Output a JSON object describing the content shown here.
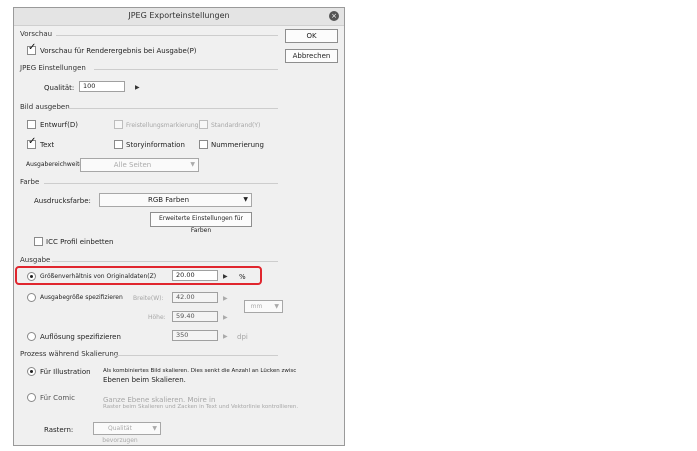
{
  "dialog": {
    "title": "JPEG Exporteinstellungen",
    "close": "×",
    "ok_label": "OK",
    "cancel_label": "Abbrechen"
  },
  "preview": {
    "section": "Vorschau",
    "checkbox_label": "Vorschau für Renderergebnis bei Ausgabe(P)",
    "checked": true
  },
  "jpeg": {
    "section": "JPEG Einstellungen",
    "quality_label": "Qualität:",
    "quality_value": "100"
  },
  "output_image": {
    "section": "Bild ausgeben",
    "draft": "Entwurf(D)",
    "border_mark": "Freistellungsmarkierung",
    "default_border": "Standardrand(Y)",
    "text": "Text",
    "text_checked": true,
    "story_info": "Storyinformation",
    "numbering": "Nummerierung",
    "range_label": "Ausgabereichweite:",
    "range_value": "Alle Seiten"
  },
  "color": {
    "section": "Farbe",
    "output_color_label": "Ausdrucksfarbe:",
    "output_color_value": "RGB Farben",
    "advanced_button": "Erweiterte Einstellungen für Farben",
    "icc_label": "ICC Profil einbetten"
  },
  "output": {
    "section": "Ausgabe",
    "ratio_label": "Größenverhältnis von Originaldaten(Z)",
    "ratio_value": "20.00",
    "ratio_unit": "%",
    "size_label": "Ausgabegröße spezifizieren",
    "width_label": "Breite(W):",
    "width_value": "42.00",
    "height_label": "Höhe:",
    "height_value": "59.40",
    "unit_value": "mm",
    "resolution_label": "Auflösung spezifizieren",
    "resolution_value": "350",
    "resolution_unit": "dpi"
  },
  "scaling": {
    "section": "Prozess während Skalierung",
    "illustration_label": "Für Illustration",
    "illustration_desc_1": "Als kombiniertes Bild skalieren. Dies senkt die Anzahl an Lücken zwisc",
    "illustration_desc_2": "Ebenen beim Skalieren.",
    "comic_label": "Für Comic",
    "comic_desc_1": "Ganze Ebene skalieren. Moire in",
    "comic_desc_2": "Raster beim Skalieren und Zacken in Text und Vektorlinie kontrollieren.",
    "raster_label": "Rastern:",
    "raster_value": "Qualität bevorzugen"
  }
}
